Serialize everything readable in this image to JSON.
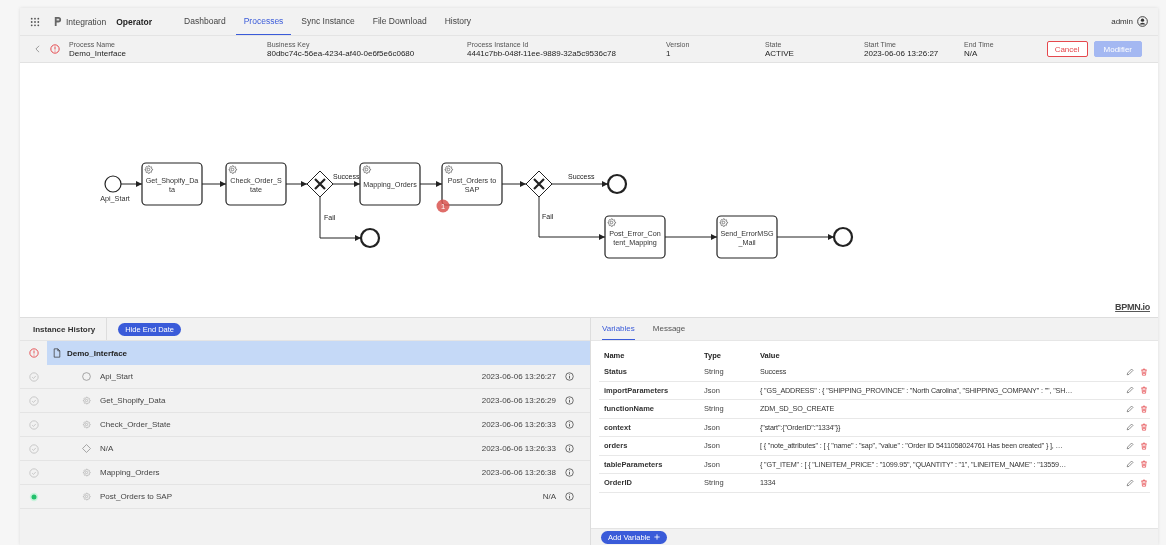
{
  "topbar": {
    "app_name": "Integration",
    "role": "Operator",
    "nav": [
      {
        "label": "Dashboard",
        "selected": false
      },
      {
        "label": "Processes",
        "selected": true
      },
      {
        "label": "Sync Instance",
        "selected": false
      },
      {
        "label": "File Download",
        "selected": false
      },
      {
        "label": "History",
        "selected": false
      }
    ],
    "user": "admin"
  },
  "process": {
    "incident": true,
    "fields": [
      {
        "label": "Process Name",
        "value": "Demo_Interface"
      },
      {
        "label": "Business Key",
        "value": "80dbc74c-56ea-4234-af40-0e6f5e6c0680"
      },
      {
        "label": "Process Instance Id",
        "value": "4441c7bb-048f-11ee-9889-32a5c9536c78"
      },
      {
        "label": "Version",
        "value": "1"
      },
      {
        "label": "State",
        "value": "ACTIVE"
      },
      {
        "label": "Start Time",
        "value": "2023-06-06 13:26:27"
      },
      {
        "label": "End Time",
        "value": "N/A"
      }
    ],
    "buttons": [
      {
        "label": "Cancel",
        "kind": "cancel",
        "disabled": false
      },
      {
        "label": "Modifier",
        "kind": "primary",
        "disabled": true
      }
    ]
  },
  "diagram": {
    "nodes": [
      {
        "kind": "start",
        "lines": [
          "Api_Start"
        ]
      },
      {
        "kind": "task",
        "lines": [
          "Get_Shopify_Da",
          "ta"
        ]
      },
      {
        "kind": "task",
        "lines": [
          "Check_Order_S",
          "tate"
        ]
      },
      {
        "kind": "gateway"
      },
      {
        "kind": "task",
        "lines": [
          "Mapping_Orders"
        ]
      },
      {
        "kind": "task",
        "lines": [
          "Post_Orders to",
          "SAP"
        ],
        "badge": "1"
      },
      {
        "kind": "gateway"
      },
      {
        "kind": "end"
      },
      {
        "kind": "end"
      },
      {
        "kind": "task",
        "lines": [
          "Post_Error_Con",
          "tent_Mapping"
        ]
      },
      {
        "kind": "task",
        "lines": [
          "Send_ErrorMSG",
          "_Mail"
        ]
      },
      {
        "kind": "end"
      }
    ],
    "flow_labels": [
      "Success",
      "Fail",
      "Success",
      "Fail"
    ],
    "viewer_logo": "BPMN.io"
  },
  "history": {
    "title": "Instance History",
    "toggle_button": "Hide End Date",
    "tree": [
      {
        "name": "Demo_Interface",
        "kind": "process",
        "incident": true,
        "selected": true,
        "children": [
          {
            "name": "Api_Start",
            "kind": "event",
            "incident": false,
            "completed": true,
            "time": "2023-06-06 13:26:27",
            "selected": false
          },
          {
            "name": "Get_Shopify_Data",
            "kind": "task",
            "incident": false,
            "completed": true,
            "time": "2023-06-06 13:26:29",
            "selected": false
          },
          {
            "name": "Check_Order_State",
            "kind": "task",
            "incident": false,
            "completed": true,
            "time": "2023-06-06 13:26:33",
            "selected": false
          },
          {
            "name": "N/A",
            "kind": "gateway",
            "incident": false,
            "completed": true,
            "time": "2023-06-06 13:26:33",
            "selected": false
          },
          {
            "name": "Mapping_Orders",
            "kind": "task",
            "incident": false,
            "completed": true,
            "time": "2023-06-06 13:26:38",
            "selected": false
          },
          {
            "name": "Post_Orders to SAP",
            "kind": "task",
            "incident": false,
            "completed": false,
            "time": "N/A",
            "selected": false
          }
        ]
      }
    ]
  },
  "variables": {
    "tabs": [
      {
        "label": "Variables",
        "selected": true
      },
      {
        "label": "Message",
        "selected": false
      }
    ],
    "columns": [
      "Name",
      "Type",
      "Value"
    ],
    "rows": [
      {
        "name": "Status",
        "type": "String",
        "value": "Success"
      },
      {
        "name": "importParameters",
        "type": "Json",
        "value": "{ \"GS_ADDRESS\" : { \"SHIPPING_PROVINCE\" : \"North Carolina\", \"SHIPPING_COMPANY\" : \"\", \"SH…"
      },
      {
        "name": "functionName",
        "type": "String",
        "value": "ZDM_SD_SO_CREATE"
      },
      {
        "name": "context",
        "type": "Json",
        "value": "{\"start\":{\"OrderID\":\"1334\"}}"
      },
      {
        "name": "orders",
        "type": "Json",
        "value": "[ { \"note_attributes\" : [ { \"name\" : \"sap\", \"value\" : \"Order ID 5411058024761 Has been created\" } ], …"
      },
      {
        "name": "tableParameters",
        "type": "Json",
        "value": "{ \"GT_ITEM\" : [ { \"LINEITEM_PRICE\" : \"1099.95\", \"QUANTITY\" : \"1\", \"LINEITEM_NAME\" : \"13559…"
      },
      {
        "name": "OrderID",
        "type": "String",
        "value": "1334"
      }
    ],
    "add_button": "Add Variable"
  }
}
